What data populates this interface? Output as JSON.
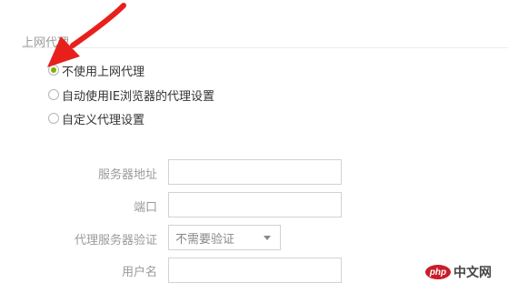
{
  "proxy": {
    "section_title": "上网代理",
    "options": [
      {
        "label": "不使用上网代理",
        "checked": true
      },
      {
        "label": "自动使用IE浏览器的代理设置",
        "checked": false
      },
      {
        "label": "自定义代理设置",
        "checked": false
      }
    ],
    "fields": {
      "server_label": "服务器地址",
      "server_value": "",
      "port_label": "端口",
      "port_value": "",
      "auth_label": "代理服务器验证",
      "auth_value": "不需要验证",
      "username_label": "用户名",
      "username_value": ""
    }
  },
  "annotation": {
    "arrow_color": "#e8201c"
  },
  "watermark": {
    "logo_text": "php",
    "site_text": "中文网"
  }
}
